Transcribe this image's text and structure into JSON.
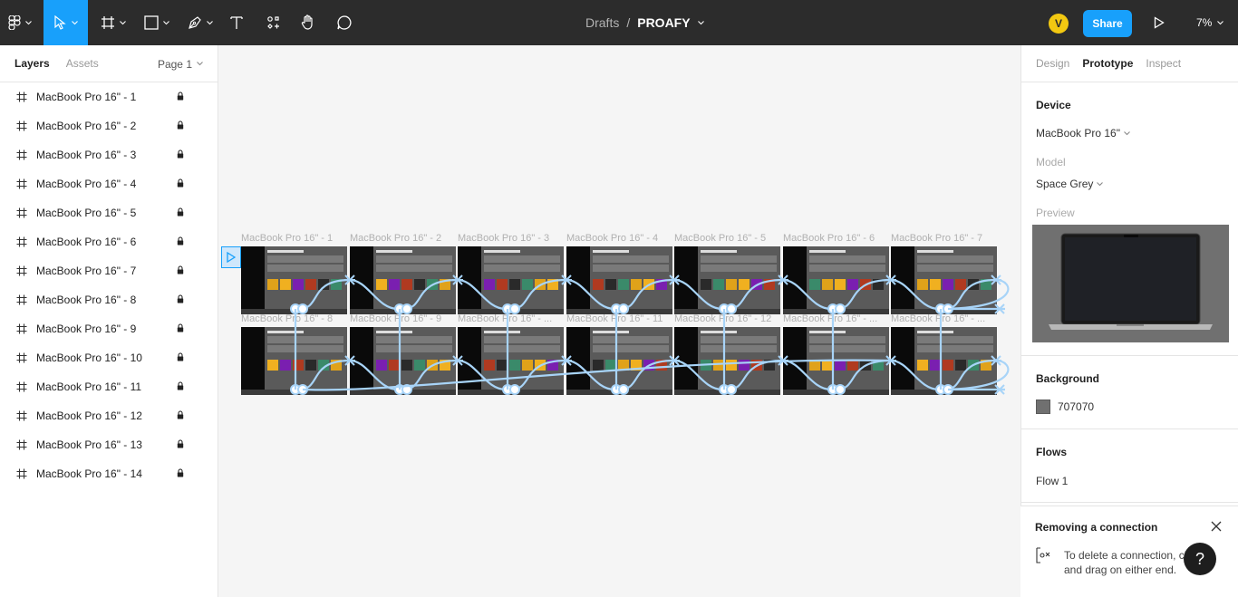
{
  "toolbar": {
    "breadcrumb": "Drafts",
    "separator": "/",
    "file_name": "PROAFY",
    "avatar_initial": "V",
    "share_label": "Share",
    "zoom": "7%",
    "accent_color": "#18a0fb"
  },
  "left_panel": {
    "tabs": {
      "layers": "Layers",
      "assets": "Assets"
    },
    "page": "Page 1",
    "layers": [
      "MacBook Pro 16\" - 1",
      "MacBook Pro 16\" - 2",
      "MacBook Pro 16\" - 3",
      "MacBook Pro 16\" - 4",
      "MacBook Pro 16\" - 5",
      "MacBook Pro 16\" - 6",
      "MacBook Pro 16\" - 7",
      "MacBook Pro 16\" - 8",
      "MacBook Pro 16\" - 9",
      "MacBook Pro 16\" - 10",
      "MacBook Pro 16\" - 11",
      "MacBook Pro 16\" - 12",
      "MacBook Pro 16\" - 13",
      "MacBook Pro 16\" - 14"
    ]
  },
  "canvas": {
    "frame_labels": [
      "MacBook Pro 16\" - 1",
      "MacBook Pro 16\" - 2",
      "MacBook Pro 16\" - 3",
      "MacBook Pro 16\" - 4",
      "MacBook Pro 16\" - 5",
      "MacBook Pro 16\" - 6",
      "MacBook Pro 16\" - 7",
      "MacBook Pro 16\" - 8",
      "MacBook Pro 16\" - 9",
      "MacBook Pro 16\" - ...",
      "MacBook Pro 16\" - 11",
      "MacBook Pro 16\" - 12",
      "MacBook Pro 16\" - ...",
      "MacBook Pro 16\" - ..."
    ]
  },
  "right_panel": {
    "tabs": {
      "design": "Design",
      "prototype": "Prototype",
      "inspect": "Inspect"
    },
    "device": {
      "title": "Device",
      "value": "MacBook Pro 16\""
    },
    "model": {
      "label": "Model",
      "value": "Space Grey"
    },
    "preview_label": "Preview",
    "background": {
      "title": "Background",
      "hex": "707070",
      "color": "#707070"
    },
    "flows": {
      "title": "Flows",
      "items": [
        "Flow 1"
      ]
    }
  },
  "tip": {
    "title": "Removing a connection",
    "text_line1": "To delete a connection, cl",
    "text_line2": "and drag on either end."
  },
  "help_label": "?"
}
